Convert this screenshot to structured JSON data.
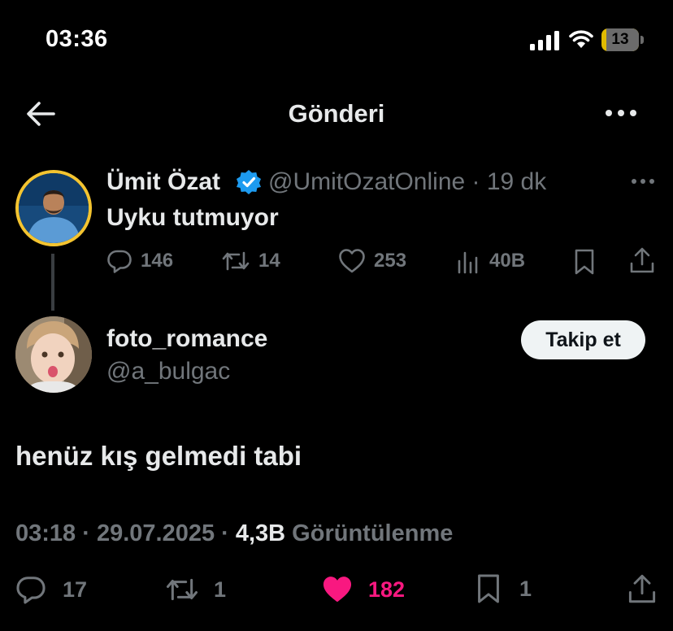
{
  "status_bar": {
    "time": "03:36",
    "battery": "13",
    "battery_level": 0.13
  },
  "header": {
    "title": "Gönderi"
  },
  "original_tweet": {
    "display_name": "Ümit Özat",
    "handle_time": "@UmitOzatOnline · 19 dk",
    "text": "Uyku tutmuyor",
    "stats": {
      "replies": "146",
      "retweets": "14",
      "likes": "253",
      "views": "40B"
    }
  },
  "reply": {
    "display_name": "foto_romance",
    "handle": "@a_bulgac",
    "follow_label": "Takip et",
    "text": "henüz kış gelmedi tabi",
    "time_date": "03:18 · 29.07.2025 · ",
    "views_count": "4,3B",
    "views_label": " Görüntülenme",
    "stats": {
      "replies": "17",
      "retweets": "1",
      "likes": "182",
      "bookmarks": "1"
    }
  },
  "colors": {
    "background": "#000000",
    "text": "#e7e9ea",
    "muted": "#71767b",
    "verified": "#1d9bf0",
    "like": "#f91880",
    "avatar_ring": "#f4c430"
  },
  "icons": [
    "back-arrow-icon",
    "more-icon",
    "verified-icon",
    "reply-icon",
    "retweet-icon",
    "like-icon",
    "views-icon",
    "bookmark-icon",
    "share-icon"
  ]
}
